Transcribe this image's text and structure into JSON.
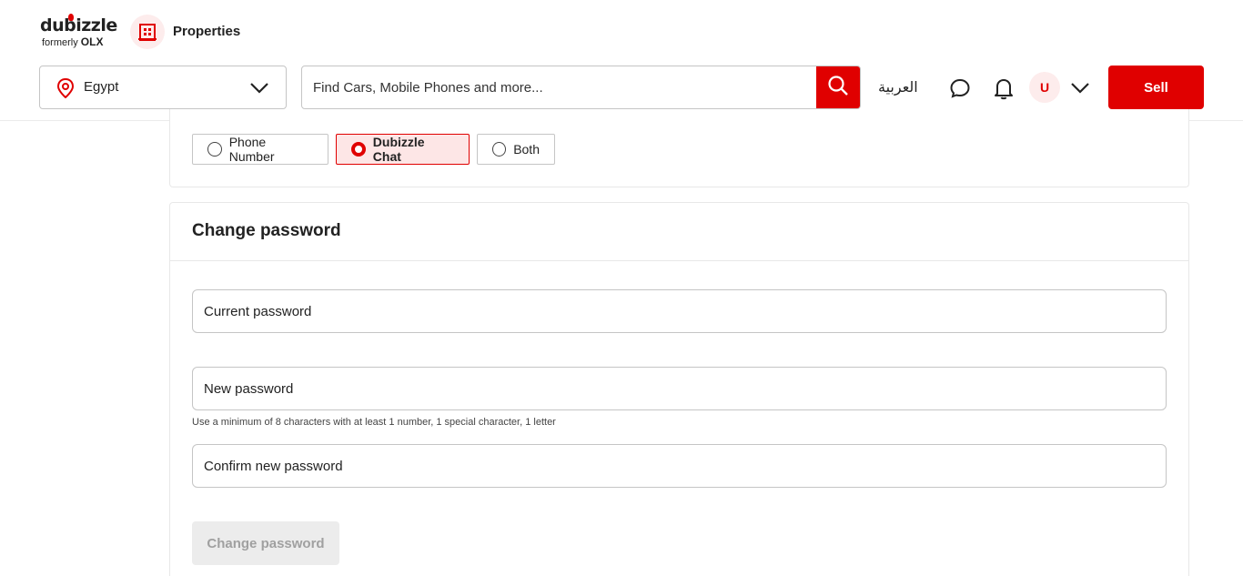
{
  "brand": {
    "name": "dubizzle",
    "tagline": "formerly",
    "former_brand": "OLX",
    "accent": "#e00000"
  },
  "category": {
    "label": "Properties",
    "icon": "building-icon"
  },
  "location": {
    "value": "Egypt",
    "icon": "location-pin-icon"
  },
  "search": {
    "placeholder": "Find Cars, Mobile Phones and more...",
    "icon": "search-icon"
  },
  "header": {
    "language_label": "العربية",
    "chat_icon": "chat-icon",
    "notifications_icon": "bell-icon",
    "avatar_initial": "U",
    "sell_label": "Sell"
  },
  "contact_method": {
    "options": [
      {
        "label": "Phone Number",
        "selected": false
      },
      {
        "label": "Dubizzle Chat",
        "selected": true
      },
      {
        "label": "Both",
        "selected": false
      }
    ]
  },
  "change_password": {
    "title": "Change password",
    "current_placeholder": "Current password",
    "new_placeholder": "New password",
    "hint": "Use a minimum of 8 characters with at least 1 number, 1 special character, 1 letter",
    "confirm_placeholder": "Confirm new password",
    "submit_label": "Change password"
  }
}
